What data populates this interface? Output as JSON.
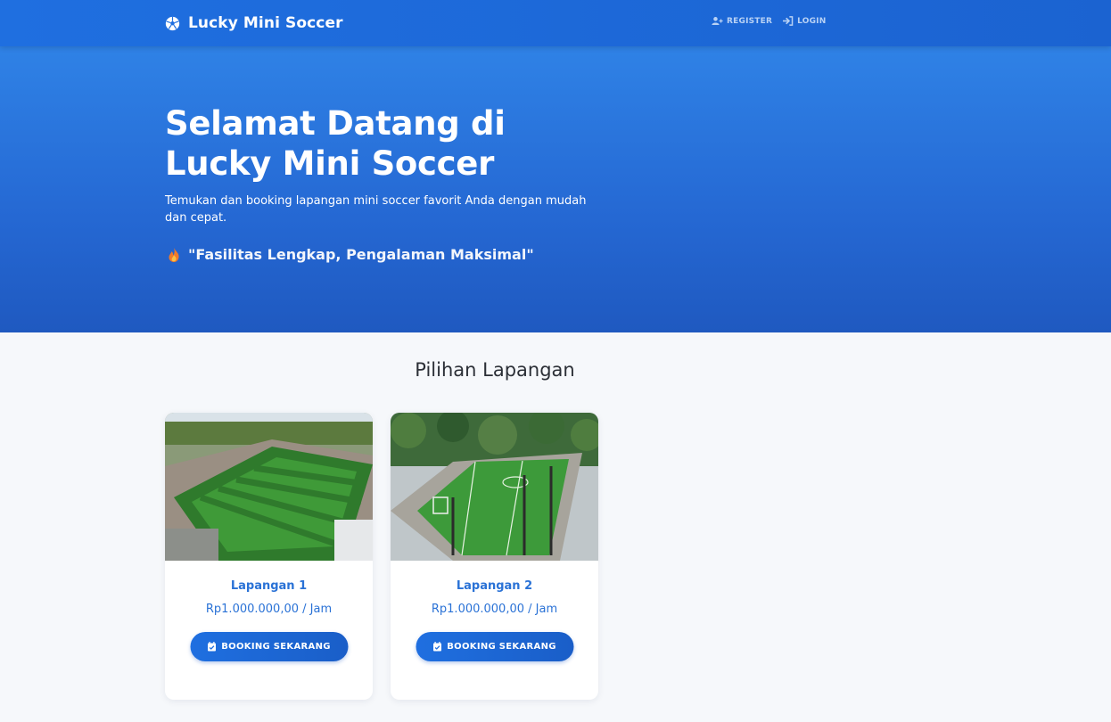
{
  "navbar": {
    "brand": "Lucky Mini Soccer",
    "brand_icon": "soccer-ball-icon",
    "links": [
      {
        "label": "REGISTER",
        "icon": "user-plus-icon"
      },
      {
        "label": "LOGIN",
        "icon": "sign-in-icon"
      }
    ]
  },
  "hero": {
    "title": "Selamat Datang di Lucky Mini Soccer",
    "subtitle": "Temukan dan booking lapangan mini soccer favorit Anda dengan mudah dan cepat.",
    "tagline": "\"Fasilitas Lengkap, Pengalaman Maksimal\"",
    "tagline_icon": "fire-icon"
  },
  "section": {
    "title": "Pilihan Lapangan"
  },
  "fields": [
    {
      "name": "Lapangan 1",
      "price": "Rp1.000.000,00 / Jam",
      "button": "BOOKING SEKARANG"
    },
    {
      "name": "Lapangan 2",
      "price": "Rp1.000.000,00 / Jam",
      "button": "BOOKING SEKARANG"
    }
  ],
  "colors": {
    "primary": "#1f6fe0",
    "accent_text": "#2a72d6",
    "background": "#f6f8fb"
  }
}
